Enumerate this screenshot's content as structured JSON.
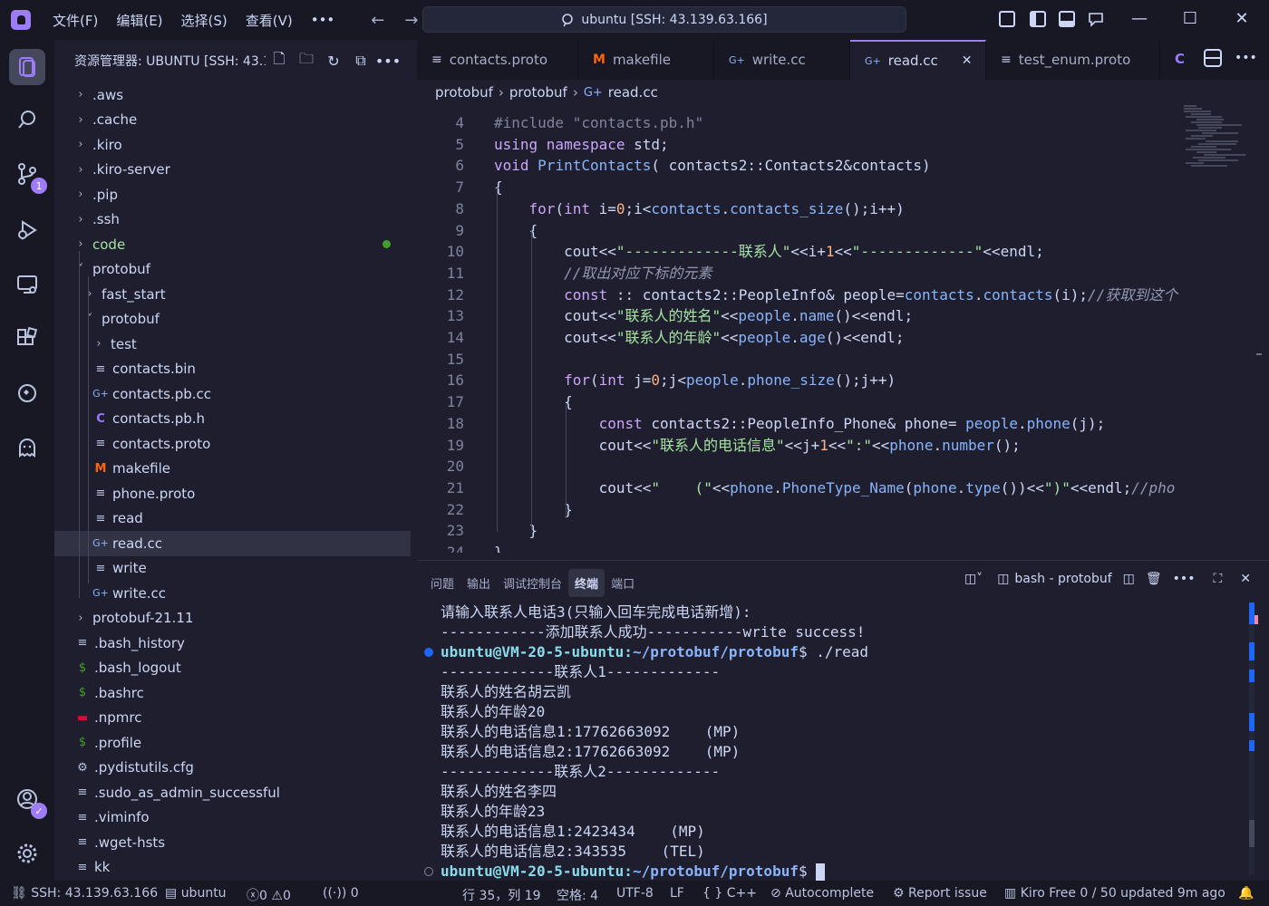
{
  "titlebar": {
    "menus": [
      "文件(F)",
      "编辑(E)",
      "选择(S)",
      "查看(V)"
    ],
    "more": "•••",
    "back": "←",
    "forward": "→",
    "command_center": "ubuntu [SSH: 43.139.63.166]"
  },
  "activitybar": {
    "scm_badge": "1"
  },
  "sidebar": {
    "title": "资源管理器: UBUNTU [SSH: 43.1...",
    "more": "•••",
    "tree": [
      {
        "label": ".aws",
        "type": "folder",
        "depth": 0,
        "open": false
      },
      {
        "label": ".cache",
        "type": "folder",
        "depth": 0,
        "open": false
      },
      {
        "label": ".kiro",
        "type": "folder",
        "depth": 0,
        "open": false
      },
      {
        "label": ".kiro-server",
        "type": "folder",
        "depth": 0,
        "open": false
      },
      {
        "label": ".pip",
        "type": "folder",
        "depth": 0,
        "open": false
      },
      {
        "label": ".ssh",
        "type": "folder",
        "depth": 0,
        "open": false
      },
      {
        "label": "code",
        "type": "folder",
        "depth": 0,
        "open": false,
        "modified": true
      },
      {
        "label": "protobuf",
        "type": "folder",
        "depth": 0,
        "open": true
      },
      {
        "label": "fast_start",
        "type": "folder",
        "depth": 1,
        "open": false
      },
      {
        "label": "protobuf",
        "type": "folder",
        "depth": 1,
        "open": true
      },
      {
        "label": "test",
        "type": "folder",
        "depth": 2,
        "open": false
      },
      {
        "label": "contacts.bin",
        "type": "text",
        "depth": 2
      },
      {
        "label": "contacts.pb.cc",
        "type": "cpp",
        "depth": 2
      },
      {
        "label": "contacts.pb.h",
        "type": "c",
        "depth": 2
      },
      {
        "label": "contacts.proto",
        "type": "text",
        "depth": 2
      },
      {
        "label": "makefile",
        "type": "make",
        "depth": 2
      },
      {
        "label": "phone.proto",
        "type": "text",
        "depth": 2
      },
      {
        "label": "read",
        "type": "text",
        "depth": 2
      },
      {
        "label": "read.cc",
        "type": "cpp",
        "depth": 2,
        "selected": true
      },
      {
        "label": "write",
        "type": "text",
        "depth": 2
      },
      {
        "label": "write.cc",
        "type": "cpp",
        "depth": 2
      },
      {
        "label": "protobuf-21.11",
        "type": "folder",
        "depth": 0,
        "open": false
      },
      {
        "label": ".bash_history",
        "type": "text",
        "depth": 0
      },
      {
        "label": ".bash_logout",
        "type": "shell",
        "depth": 0
      },
      {
        "label": ".bashrc",
        "type": "shell",
        "depth": 0
      },
      {
        "label": ".npmrc",
        "type": "npm",
        "depth": 0
      },
      {
        "label": ".profile",
        "type": "shell",
        "depth": 0
      },
      {
        "label": ".pydistutils.cfg",
        "type": "gear",
        "depth": 0
      },
      {
        "label": ".sudo_as_admin_successful",
        "type": "text",
        "depth": 0
      },
      {
        "label": ".viminfo",
        "type": "text",
        "depth": 0
      },
      {
        "label": ".wget-hsts",
        "type": "text",
        "depth": 0
      },
      {
        "label": "kk",
        "type": "text",
        "depth": 0
      }
    ]
  },
  "editor": {
    "tabs": [
      {
        "label": "contacts.proto",
        "icon": "text"
      },
      {
        "label": "makefile",
        "icon": "make"
      },
      {
        "label": "write.cc",
        "icon": "cpp"
      },
      {
        "label": "read.cc",
        "icon": "cpp",
        "active": true
      },
      {
        "label": "test_enum.proto",
        "icon": "text"
      }
    ],
    "breadcrumb": [
      "protobuf",
      "protobuf",
      "read.cc"
    ],
    "partial_top_line": "#include \"contacts.pb.h\"",
    "lines": [
      {
        "n": "4",
        "t": []
      },
      {
        "n": "5",
        "t": [
          [
            "kw",
            "using "
          ],
          [
            "kw",
            "namespace "
          ],
          [
            "pl",
            "std;"
          ]
        ]
      },
      {
        "n": "6",
        "t": [
          [
            "ty",
            "void "
          ],
          [
            "fn",
            "PrintContacts"
          ],
          [
            "pl",
            "( contacts2::Contacts2&contacts)"
          ]
        ]
      },
      {
        "n": "7",
        "t": [
          [
            "pl",
            "{"
          ]
        ]
      },
      {
        "n": "8",
        "t": [
          [
            "pl",
            "    "
          ],
          [
            "kw",
            "for"
          ],
          [
            "pl",
            "("
          ],
          [
            "ty",
            "int "
          ],
          [
            "pl",
            "i="
          ],
          [
            "nm",
            "0"
          ],
          [
            "pl",
            ";i<"
          ],
          [
            "fn",
            "contacts"
          ],
          [
            "pl",
            "."
          ],
          [
            "fn",
            "contacts_size"
          ],
          [
            "pl",
            "();i++)"
          ]
        ]
      },
      {
        "n": "9",
        "t": [
          [
            "pl",
            "    {"
          ]
        ]
      },
      {
        "n": "10",
        "t": [
          [
            "pl",
            "        cout<<"
          ],
          [
            "st",
            "\"-------------联系人\""
          ],
          [
            "pl",
            "<<i+"
          ],
          [
            "nm",
            "1"
          ],
          [
            "pl",
            "<<"
          ],
          [
            "st",
            "\"-------------\""
          ],
          [
            "pl",
            "<<endl;"
          ]
        ]
      },
      {
        "n": "11",
        "t": [
          [
            "cm",
            "        //取出对应下标的元素"
          ]
        ]
      },
      {
        "n": "12",
        "t": [
          [
            "pl",
            "        "
          ],
          [
            "kw",
            "const "
          ],
          [
            "pl",
            ":: contacts2::PeopleInfo& people="
          ],
          [
            "fn",
            "contacts"
          ],
          [
            "pl",
            "."
          ],
          [
            "fn",
            "contacts"
          ],
          [
            "pl",
            "(i);"
          ],
          [
            "cm",
            "//获取到这个"
          ]
        ]
      },
      {
        "n": "13",
        "t": [
          [
            "pl",
            "        cout<<"
          ],
          [
            "st",
            "\"联系人的姓名\""
          ],
          [
            "pl",
            "<<"
          ],
          [
            "fn",
            "people"
          ],
          [
            "pl",
            "."
          ],
          [
            "fn",
            "name"
          ],
          [
            "pl",
            "()<<endl;"
          ]
        ]
      },
      {
        "n": "14",
        "t": [
          [
            "pl",
            "        cout<<"
          ],
          [
            "st",
            "\"联系人的年龄\""
          ],
          [
            "pl",
            "<<"
          ],
          [
            "fn",
            "people"
          ],
          [
            "pl",
            "."
          ],
          [
            "fn",
            "age"
          ],
          [
            "pl",
            "()<<endl;"
          ]
        ]
      },
      {
        "n": "15",
        "t": []
      },
      {
        "n": "16",
        "t": [
          [
            "pl",
            "        "
          ],
          [
            "kw",
            "for"
          ],
          [
            "pl",
            "("
          ],
          [
            "ty",
            "int "
          ],
          [
            "pl",
            "j="
          ],
          [
            "nm",
            "0"
          ],
          [
            "pl",
            ";j<"
          ],
          [
            "fn",
            "people"
          ],
          [
            "pl",
            "."
          ],
          [
            "fn",
            "phone_size"
          ],
          [
            "pl",
            "();j++)"
          ]
        ]
      },
      {
        "n": "17",
        "t": [
          [
            "pl",
            "        {"
          ]
        ]
      },
      {
        "n": "18",
        "t": [
          [
            "pl",
            "            "
          ],
          [
            "kw",
            "const "
          ],
          [
            "pl",
            "contacts2::PeopleInfo_Phone& phone= "
          ],
          [
            "fn",
            "people"
          ],
          [
            "pl",
            "."
          ],
          [
            "fn",
            "phone"
          ],
          [
            "pl",
            "(j);"
          ]
        ]
      },
      {
        "n": "19",
        "t": [
          [
            "pl",
            "            cout<<"
          ],
          [
            "st",
            "\"联系人的电话信息\""
          ],
          [
            "pl",
            "<<j+"
          ],
          [
            "nm",
            "1"
          ],
          [
            "pl",
            "<<"
          ],
          [
            "st",
            "\":\""
          ],
          [
            "pl",
            "<<"
          ],
          [
            "fn",
            "phone"
          ],
          [
            "pl",
            "."
          ],
          [
            "fn",
            "number"
          ],
          [
            "pl",
            "();"
          ]
        ]
      },
      {
        "n": "20",
        "t": []
      },
      {
        "n": "21",
        "t": [
          [
            "pl",
            "            cout<<"
          ],
          [
            "st",
            "\"    (\""
          ],
          [
            "pl",
            "<<"
          ],
          [
            "fn",
            "phone"
          ],
          [
            "pl",
            "."
          ],
          [
            "fn",
            "PhoneType_Name"
          ],
          [
            "pl",
            "("
          ],
          [
            "fn",
            "phone"
          ],
          [
            "pl",
            "."
          ],
          [
            "fn",
            "type"
          ],
          [
            "pl",
            "())<<"
          ],
          [
            "st",
            "\")\""
          ],
          [
            "pl",
            "<<endl;"
          ],
          [
            "cm",
            "//pho"
          ]
        ]
      },
      {
        "n": "22",
        "t": [
          [
            "pl",
            "        }"
          ]
        ]
      },
      {
        "n": "23",
        "t": [
          [
            "pl",
            "    }"
          ]
        ]
      },
      {
        "n": "24",
        "t": [
          [
            "pl",
            "}"
          ]
        ]
      }
    ]
  },
  "panel": {
    "tabs": [
      "问题",
      "输出",
      "调试控制台",
      "终端",
      "端口"
    ],
    "active_tab": "终端",
    "terminal_name": "bash - protobuf",
    "more": "•••",
    "terminal_lines": [
      {
        "text": "请输入联系人电话3(只输入回车完成电话新增):"
      },
      {
        "text": "------------添加联系人成功-----------write success!"
      },
      {
        "prompt": true,
        "user": "ubuntu@VM-20-5-ubuntu",
        "path": "~/protobuf/protobuf",
        "cmd": "$ ./read",
        "dot": "blue"
      },
      {
        "text": "-------------联系人1-------------"
      },
      {
        "text": "联系人的姓名胡云凯"
      },
      {
        "text": "联系人的年龄20"
      },
      {
        "text": "联系人的电话信息1:17762663092    (MP)"
      },
      {
        "text": "联系人的电话信息2:17762663092    (MP)"
      },
      {
        "text": "-------------联系人2-------------"
      },
      {
        "text": "联系人的姓名李四"
      },
      {
        "text": "联系人的年龄23"
      },
      {
        "text": "联系人的电话信息1:2423434    (MP)"
      },
      {
        "text": "联系人的电话信息2:343535    (TEL)"
      },
      {
        "prompt": true,
        "user": "ubuntu@VM-20-5-ubuntu",
        "path": "~/protobuf/protobuf",
        "cmd": "$ ",
        "dot": "hollow",
        "cursor": true
      }
    ]
  },
  "statusbar": {
    "remote": "SSH: 43.139.63.166",
    "workspace": "ubuntu",
    "errors": "0",
    "warnings": "0",
    "ports": "0",
    "position": "行 35，列 19",
    "spaces": "空格: 4",
    "encoding": "UTF-8",
    "eol": "LF",
    "language": "{ } C++",
    "autocomplete": "Autocomplete",
    "report": "Report issue",
    "plan": "Kiro Free 0 / 50 updated 9m ago"
  }
}
